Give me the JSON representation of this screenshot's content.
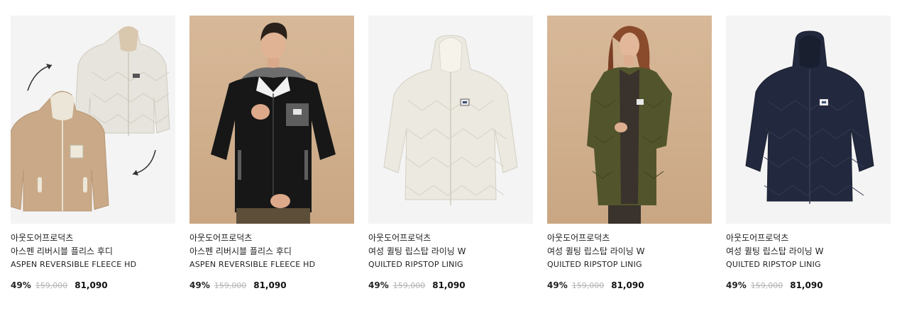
{
  "products": [
    {
      "brand": "아웃도어프로덕츠",
      "name_ko": "아스펜 리버시블 플리스 후디",
      "name_en": "ASPEN REVERSIBLE FLEECE HD",
      "discount": "49%",
      "original_price": "159,000",
      "sale_price": "81,090",
      "image": "reversible-fleece-hoodie-product-shot"
    },
    {
      "brand": "아웃도어프로덕츠",
      "name_ko": "아스펜 리버시블 플리스 후디",
      "name_en": "ASPEN REVERSIBLE FLEECE HD",
      "discount": "49%",
      "original_price": "159,000",
      "sale_price": "81,090",
      "image": "male-model-black-fleece-hoodie"
    },
    {
      "brand": "아웃도어프로덕츠",
      "name_ko": "여성 퀼팅 립스탑 라이닝 W",
      "name_en": "QUILTED RIPSTOP LINIG",
      "discount": "49%",
      "original_price": "159,000",
      "sale_price": "81,090",
      "image": "ivory-quilted-long-coat"
    },
    {
      "brand": "아웃도어프로덕츠",
      "name_ko": "여성 퀼팅 립스탑 라이닝 W",
      "name_en": "QUILTED RIPSTOP LINIG",
      "discount": "49%",
      "original_price": "159,000",
      "sale_price": "81,090",
      "image": "female-model-khaki-quilted-coat"
    },
    {
      "brand": "아웃도어프로덕츠",
      "name_ko": "여성 퀼팅 립스탑 라이닝 W",
      "name_en": "QUILTED RIPSTOP LINIG",
      "discount": "49%",
      "original_price": "159,000",
      "sale_price": "81,090",
      "image": "navy-quilted-long-coat"
    }
  ],
  "colors": {
    "light_bg": "#f4f4f4",
    "tan_bg": "#d4b593",
    "strike": "#b3b3b3"
  }
}
